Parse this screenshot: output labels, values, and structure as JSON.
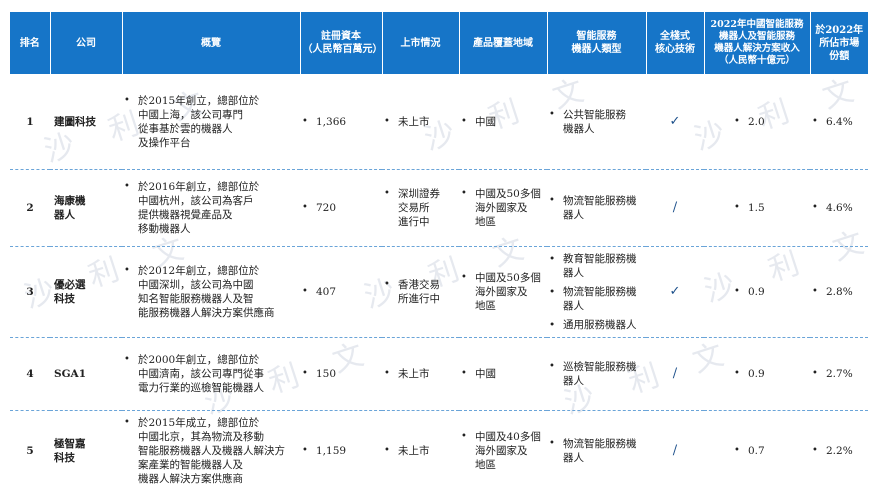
{
  "watermark": "沙 利 文",
  "headers": {
    "rank": "排名",
    "company": "公司",
    "overview": "概覽",
    "capital": "註冊資本\n（人民幣百萬元）",
    "listing": "上市情況",
    "coverage": "產品覆蓋地域",
    "robot_type": "智能服務\n機器人類型",
    "fullstack": "全棧式\n核心技術",
    "revenue": "2022年中國智能服務\n機器人及智能服務\n機器人解決方案收入\n（人民幣十億元）",
    "share": "於2022年\n所佔市場\n份額"
  },
  "rows": [
    {
      "rank": "1",
      "company": "建圖科技",
      "overview": "於2015年創立，總部位於\n中國上海，該公司專門\n從事基於雲的機器人\n及操作平台",
      "capital": "1,366",
      "listing": "未上市",
      "coverage": "中國",
      "robot_types": [
        "公共智能服務\n機器人"
      ],
      "fullstack": "✓",
      "revenue": "2.0",
      "share": "6.4%"
    },
    {
      "rank": "2",
      "company": "海康機\n器人",
      "overview": "於2016年創立，總部位於\n中國杭州，該公司為客戶\n提供機器視覺產品及\n移動機器人",
      "capital": "720",
      "listing": "深圳證券\n交易所\n進行中",
      "coverage": "中國及50多個\n海外國家及\n地區",
      "robot_types": [
        "物流智能服務機器人"
      ],
      "fullstack": "/",
      "revenue": "1.5",
      "share": "4.6%"
    },
    {
      "rank": "3",
      "company": "優必選\n科技",
      "overview": "於2012年創立，總部位於\n中國深圳，該公司為中國\n知名智能服務機器人及智\n能服務機器人解決方案供應商",
      "capital": "407",
      "listing": "香港交易\n所進行中",
      "coverage": "中國及50多個\n海外國家及\n地區",
      "robot_types": [
        "教育智能服務機器人",
        "物流智能服務機器人",
        "通用服務機器人"
      ],
      "fullstack": "✓",
      "revenue": "0.9",
      "share": "2.8%"
    },
    {
      "rank": "4",
      "company": "SGA1",
      "overview": "於2000年創立，總部位於\n中國濟南，該公司專門從事\n電力行業的巡檢智能機器人",
      "capital": "150",
      "listing": "未上市",
      "coverage": "中國",
      "robot_types": [
        "巡檢智能服務機器人"
      ],
      "fullstack": "/",
      "revenue": "0.9",
      "share": "2.7%"
    },
    {
      "rank": "5",
      "company": "極智嘉\n科技",
      "overview": "於2015年成立，總部位於\n中國北京，其為物流及移動\n智能服務機器人及機器人解決方\n案產業的智能機器人及\n機器人解決方案供應商",
      "capital": "1,159",
      "listing": "未上市",
      "coverage": "中國及40多個\n海外國家及\n地區",
      "robot_types": [
        "物流智能服務機器人"
      ],
      "fullstack": "/",
      "revenue": "0.7",
      "share": "2.2%"
    }
  ]
}
